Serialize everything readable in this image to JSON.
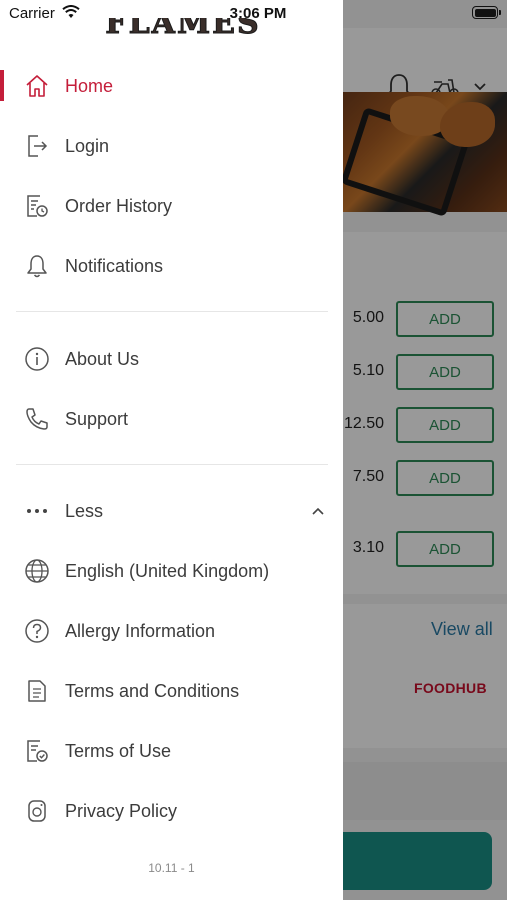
{
  "status_bar": {
    "carrier": "Carrier",
    "time": "3:06 PM"
  },
  "drawer": {
    "logo_text": "FLAMES",
    "menu": [
      {
        "label": "Home",
        "icon": "home-icon",
        "active": true
      },
      {
        "label": "Login",
        "icon": "login-icon"
      },
      {
        "label": "Order History",
        "icon": "order-history-icon"
      },
      {
        "label": "Notifications",
        "icon": "bell-icon"
      },
      {
        "label": "About Us",
        "icon": "info-icon"
      },
      {
        "label": "Support",
        "icon": "phone-icon"
      },
      {
        "label": "Less",
        "icon": "more-dots-icon"
      },
      {
        "label": "English (United Kingdom)",
        "icon": "globe-icon"
      },
      {
        "label": "Allergy Information",
        "icon": "question-icon"
      },
      {
        "label": "Terms and Conditions",
        "icon": "document-icon"
      },
      {
        "label": "Terms of Use",
        "icon": "document-check-icon"
      },
      {
        "label": "Privacy Policy",
        "icon": "privacy-icon"
      }
    ],
    "version": "10.11 - 1"
  },
  "background": {
    "items": [
      {
        "price": "5.00",
        "add_label": "ADD"
      },
      {
        "price": "5.10",
        "add_label": "ADD"
      },
      {
        "price": "12.50",
        "add_label": "ADD"
      },
      {
        "price": "7.50",
        "add_label": "ADD"
      },
      {
        "price": "3.10",
        "add_label": "ADD"
      }
    ],
    "view_all": "View all",
    "brand": "FOODHUB"
  },
  "colors": {
    "accent": "#c41e3a",
    "add_button": "#2e8b57",
    "link": "#2a7aa5",
    "cta": "#1a8f86"
  }
}
